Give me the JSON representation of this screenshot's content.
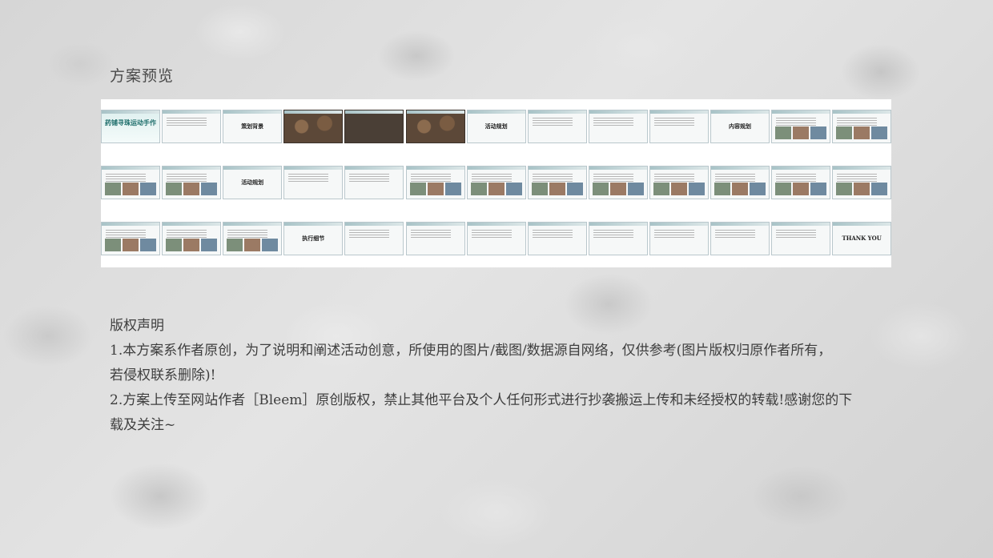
{
  "header": {
    "title": "方案预览"
  },
  "preview": {
    "rows": [
      [
        {
          "type": "cover",
          "text": "药铺寻珠运动手作参考"
        },
        {
          "type": "lines",
          "text": ""
        },
        {
          "type": "big",
          "text": "策划背景"
        },
        {
          "type": "beans",
          "text": ""
        },
        {
          "type": "dark",
          "text": ""
        },
        {
          "type": "beans",
          "text": ""
        },
        {
          "type": "big",
          "text": "活动规划"
        },
        {
          "type": "lines",
          "text": ""
        },
        {
          "type": "lines",
          "text": ""
        },
        {
          "type": "lines",
          "text": ""
        },
        {
          "type": "big",
          "text": "内容规划"
        },
        {
          "type": "pics",
          "text": ""
        },
        {
          "type": "pics",
          "text": ""
        }
      ],
      [
        {
          "type": "pics",
          "text": ""
        },
        {
          "type": "pics",
          "text": ""
        },
        {
          "type": "big",
          "text": "活动规划"
        },
        {
          "type": "lines",
          "text": ""
        },
        {
          "type": "lines",
          "text": ""
        },
        {
          "type": "pics",
          "text": ""
        },
        {
          "type": "pics",
          "text": ""
        },
        {
          "type": "pics",
          "text": ""
        },
        {
          "type": "pics",
          "text": ""
        },
        {
          "type": "pics",
          "text": ""
        },
        {
          "type": "pics",
          "text": ""
        },
        {
          "type": "pics",
          "text": ""
        },
        {
          "type": "pics",
          "text": ""
        }
      ],
      [
        {
          "type": "pics",
          "text": ""
        },
        {
          "type": "pics",
          "text": ""
        },
        {
          "type": "pics",
          "text": ""
        },
        {
          "type": "big",
          "text": "执行细节"
        },
        {
          "type": "lines",
          "text": ""
        },
        {
          "type": "lines",
          "text": ""
        },
        {
          "type": "lines",
          "text": ""
        },
        {
          "type": "lines",
          "text": ""
        },
        {
          "type": "lines",
          "text": ""
        },
        {
          "type": "lines",
          "text": ""
        },
        {
          "type": "lines",
          "text": ""
        },
        {
          "type": "lines",
          "text": ""
        },
        {
          "type": "big",
          "text": "THANK YOU"
        }
      ]
    ]
  },
  "copyright": {
    "heading": "版权声明",
    "line1": "1.本方案系作者原创，为了说明和阐述活动创意，所使用的图片/截图/数据源自网络，仅供参考(图片版权归原作者所有，",
    "line1b": "若侵权联系删除)!",
    "line2": "2.方案上传至网站作者［Bleem］原创版权，禁止其他平台及个人任何形式进行抄袭搬运上传和未经授权的转载!感谢您的下",
    "line2b": "载及关注~"
  }
}
